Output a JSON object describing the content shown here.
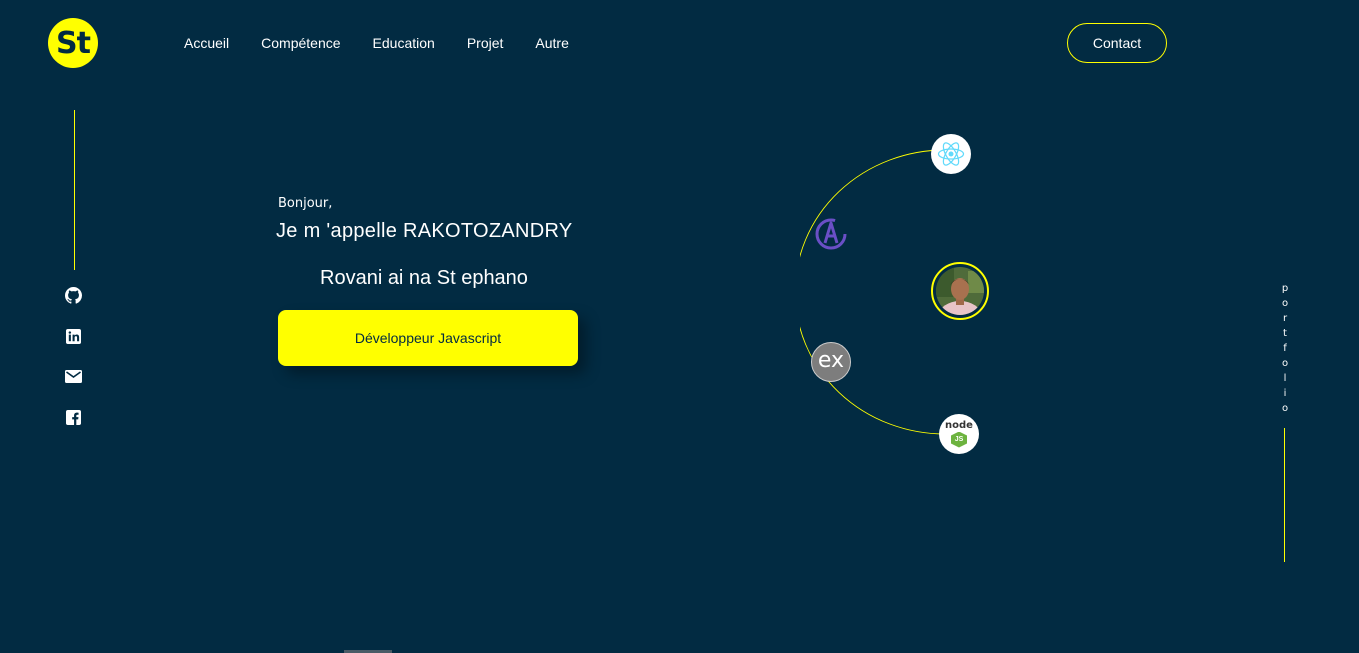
{
  "header": {
    "logo_text": "St",
    "nav": [
      "Accueil",
      "Compétence",
      "Education",
      "Projet",
      "Autre"
    ],
    "contact_label": "Contact"
  },
  "social": {
    "icons": [
      "github-icon",
      "linkedin-icon",
      "email-icon",
      "facebook-icon"
    ]
  },
  "hero": {
    "greeting": "Bonjour,",
    "name_line1": "Je  m 'appelle  RAKOTOZANDRY",
    "name_line2": "Rovani ai na  St ephano",
    "role_label": "Développeur Javascript"
  },
  "orbit": {
    "icons": [
      "react-icon",
      "apollo-icon",
      "express-icon",
      "nodejs-icon"
    ],
    "express_label": "ex",
    "node_label": "node",
    "node_js_label": "JS"
  },
  "side": {
    "portfolio_letters": [
      "p",
      "o",
      "r",
      "t",
      "f",
      "o",
      "l",
      "i",
      "o"
    ]
  },
  "colors": {
    "background": "#022b42",
    "accent": "#ffff00",
    "text": "#ffffff"
  }
}
